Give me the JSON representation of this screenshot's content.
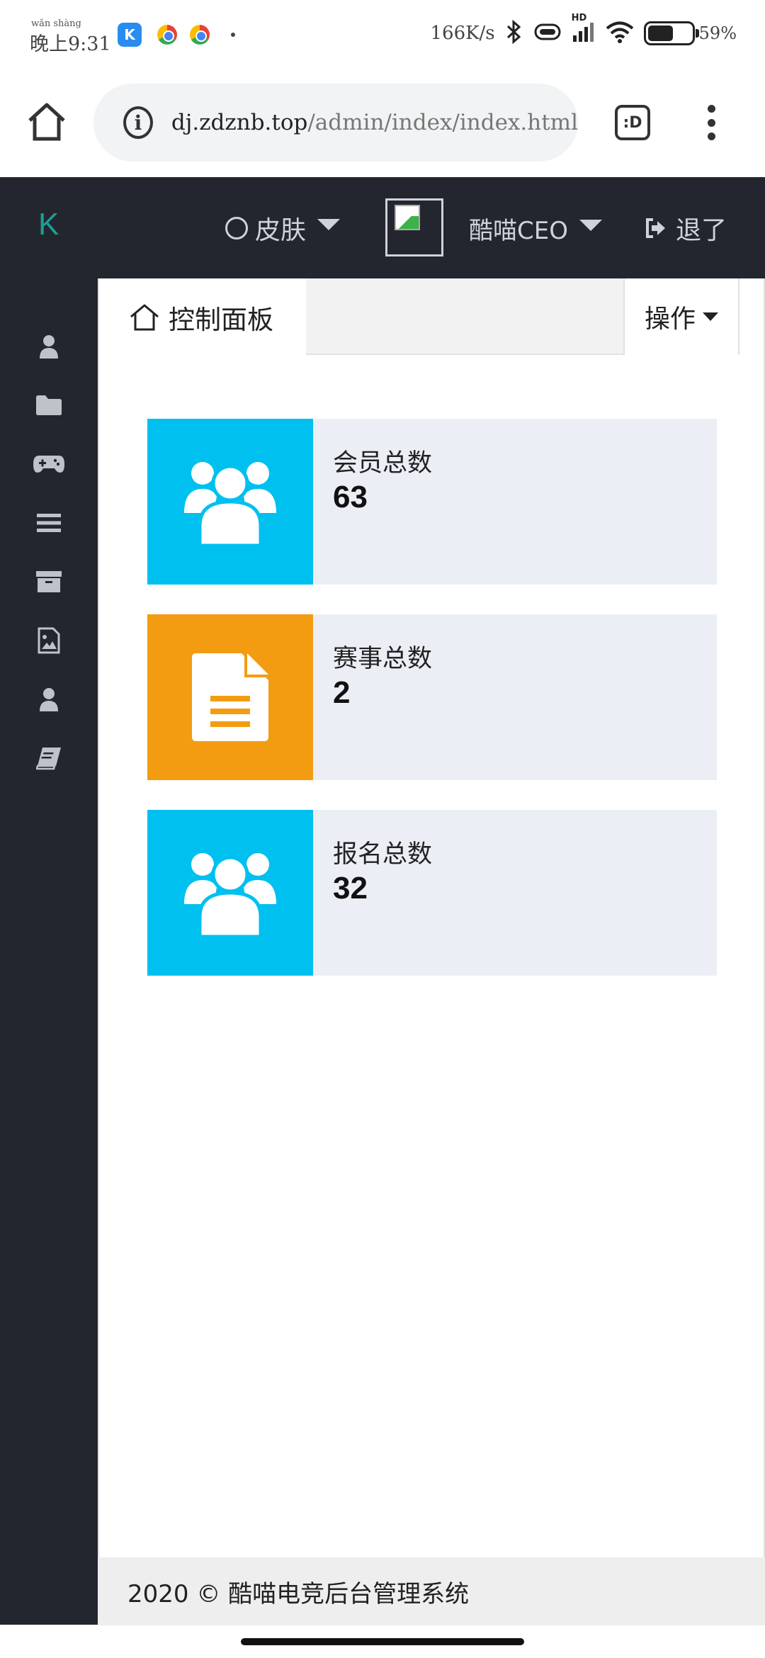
{
  "status_bar": {
    "pinyin": "wǎn shàng",
    "time": "晚上9:31",
    "app_badge": "K",
    "net_speed": "166K/s",
    "network_badge": "HD",
    "battery_level": 0.59,
    "battery_text": "59%"
  },
  "browser": {
    "url_host": "dj.zdznb.top",
    "url_path": "/admin/index/index.html",
    "tab_switcher_label": ":D"
  },
  "header": {
    "logo": "K",
    "skin_label": "皮肤",
    "user_label": "酷喵CEO",
    "logout_label": "退了",
    "accent_color": "#1aa094"
  },
  "sidebar": {
    "items": [
      {
        "icon": "user-icon"
      },
      {
        "icon": "folder-icon"
      },
      {
        "icon": "gamepad-icon"
      },
      {
        "icon": "list-icon"
      },
      {
        "icon": "archive-icon"
      },
      {
        "icon": "image-icon"
      },
      {
        "icon": "user-icon"
      },
      {
        "icon": "book-icon"
      }
    ]
  },
  "main": {
    "tab_home_label": "控制面板",
    "ops_label": "操作",
    "cards": [
      {
        "label": "会员总数",
        "value": "63",
        "icon": "users-icon",
        "color": "#00c0ef"
      },
      {
        "label": "赛事总数",
        "value": "2",
        "icon": "document-icon",
        "color": "#f39c12"
      },
      {
        "label": "报名总数",
        "value": "32",
        "icon": "users-icon",
        "color": "#00c0ef"
      }
    ]
  },
  "footer": {
    "text": "2020 © 酷喵电竞后台管理系统"
  }
}
